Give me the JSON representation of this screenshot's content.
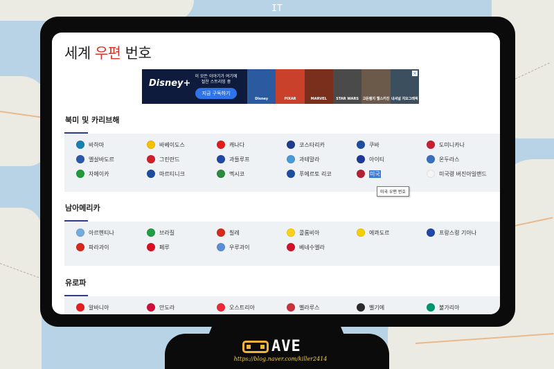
{
  "frame_label": "IT",
  "page_title_parts": [
    "세계",
    "우편",
    "번호"
  ],
  "ad": {
    "brand": "Disney+",
    "copy": "이 모든 이야기가 여기에\n절찬 스트리밍 중",
    "button": "지금 구독하기",
    "tiles": [
      "Disney",
      "PIXAR",
      "MARVEL",
      "STAR WARS",
      "고든램지 헬스키친",
      "내셔널 지오그래픽"
    ],
    "tile_colors": [
      "#2c5aa0",
      "#c9412b",
      "#7a2f1c",
      "#4a4a4a",
      "#6b5a4a",
      "#3b4f5e"
    ]
  },
  "sections": [
    {
      "heading": "북미 및 카리브해",
      "countries": [
        {
          "name": "바하마",
          "flag": "#1a7fb3"
        },
        {
          "name": "바베이도스",
          "flag": "#f3c100"
        },
        {
          "name": "캐나다",
          "flag": "#e21c1c"
        },
        {
          "name": "코스타리카",
          "flag": "#1f3d8c"
        },
        {
          "name": "쿠바",
          "flag": "#1d4fa0"
        },
        {
          "name": "도미니카나",
          "flag": "#c8202f"
        },
        {
          "name": "엘살바도르",
          "flag": "#2b5aa8"
        },
        {
          "name": "그린란드",
          "flag": "#d0202e"
        },
        {
          "name": "과들루프",
          "flag": "#2147a8"
        },
        {
          "name": "과테말라",
          "flag": "#4b9ad8"
        },
        {
          "name": "아이티",
          "flag": "#1d3b96"
        },
        {
          "name": "온두라스",
          "flag": "#3a6fc0"
        },
        {
          "name": "자메이카",
          "flag": "#1f9b3a"
        },
        {
          "name": "마르티니크",
          "flag": "#1b4d9c"
        },
        {
          "name": "멕시코",
          "flag": "#2b8a3e"
        },
        {
          "name": "푸에르토 리코",
          "flag": "#1d4fa0"
        },
        {
          "name": "미국",
          "flag": "#b22234"
        },
        {
          "name": "미국령 버진아일랜드",
          "flag": "#f4f4f4"
        }
      ]
    },
    {
      "heading": "남아메리카",
      "countries": [
        {
          "name": "아르헨티나",
          "flag": "#74acdf"
        },
        {
          "name": "브라질",
          "flag": "#229e45"
        },
        {
          "name": "칠레",
          "flag": "#d52b1e"
        },
        {
          "name": "콜롬비아",
          "flag": "#fcd116"
        },
        {
          "name": "에콰도르",
          "flag": "#f5d000"
        },
        {
          "name": "프랑스령 기아나",
          "flag": "#2147a8"
        },
        {
          "name": "파라과이",
          "flag": "#d52b1e"
        },
        {
          "name": "페루",
          "flag": "#d91023"
        },
        {
          "name": "우루과이",
          "flag": "#5a8fd8"
        },
        {
          "name": "베네수엘라",
          "flag": "#cf142b"
        }
      ]
    },
    {
      "heading": "유로파",
      "countries": [
        {
          "name": "알바니아",
          "flag": "#e41e20"
        },
        {
          "name": "안도라",
          "flag": "#d0103a"
        },
        {
          "name": "오스트리아",
          "flag": "#ed2939"
        },
        {
          "name": "벨라루스",
          "flag": "#c8313e"
        },
        {
          "name": "벨기에",
          "flag": "#2b2b2b"
        },
        {
          "name": "불가리아",
          "flag": "#00966e"
        }
      ]
    }
  ],
  "selected_country": "미국",
  "tooltip": "미국 우편 번호",
  "logo": {
    "text": "AVE",
    "url": "https://blog.naver.com/killer2414"
  }
}
